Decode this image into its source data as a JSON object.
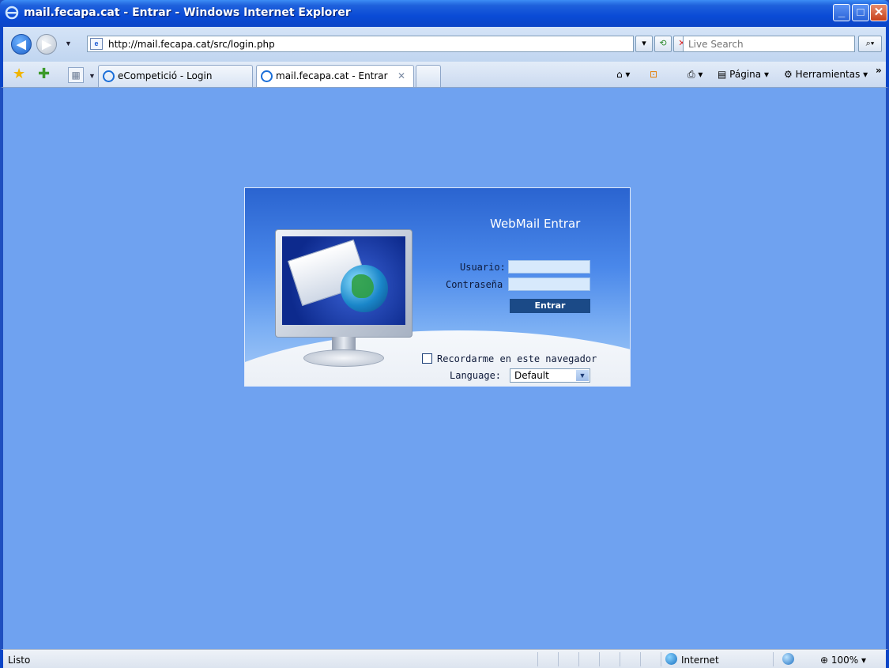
{
  "window": {
    "title": "mail.fecapa.cat - Entrar - Windows Internet Explorer"
  },
  "address_bar": {
    "url": "http://mail.fecapa.cat/src/login.php"
  },
  "search": {
    "placeholder": "Live Search"
  },
  "tabs": [
    {
      "label": "eCompetició - Login",
      "active": false
    },
    {
      "label": "mail.fecapa.cat - Entrar",
      "active": true
    }
  ],
  "command_bar": {
    "page_label": "Página",
    "tools_label": "Herramientas"
  },
  "login": {
    "title": "WebMail Entrar",
    "username_label": "Usuario:",
    "password_label": "Contraseña",
    "submit_label": "Entrar",
    "remember_label": "Recordarme en este navegador",
    "language_label": "Language:",
    "language_value": "Default"
  },
  "status_bar": {
    "status": "Listo",
    "zone": "Internet",
    "zoom": "100%"
  },
  "colors": {
    "page_background": "#6fa2f0",
    "titlebar": "#0b45c7",
    "login_button": "#1b4a87"
  }
}
